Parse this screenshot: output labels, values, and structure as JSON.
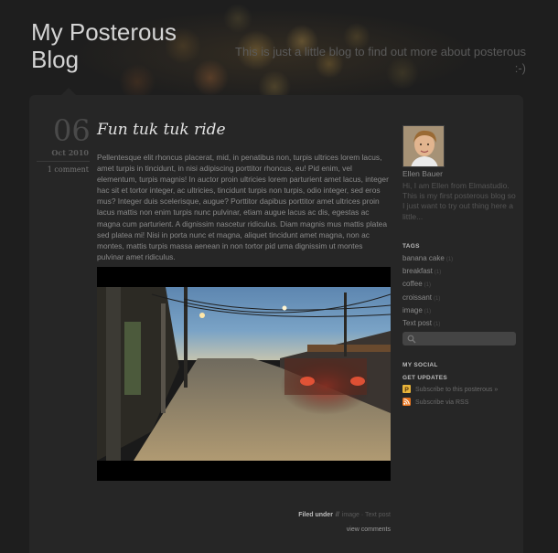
{
  "header": {
    "site_title": "My Posterous Blog",
    "tagline": "This is just a little blog to find out more about posterous :-)"
  },
  "post": {
    "day": "06",
    "month_year": "Oct 2010",
    "comments": "1 comment",
    "title": "Fun tuk tuk ride",
    "body": "Pellentesque elit rhoncus placerat, mid, in penatibus non, turpis ultrices lorem lacus, amet turpis in tincidunt, in nisi adipiscing porttitor rhoncus, eu! Pid enim, vel elementum, turpis magnis! In auctor proin ultricies lorem parturient amet lacus, integer hac sit et tortor integer, ac ultricies, tincidunt turpis non turpis, odio integer, sed eros mus? Integer duis scelerisque, augue? Porttitor dapibus porttitor amet ultrices proin lacus mattis non enim turpis nunc pulvinar, etiam augue lacus ac dis, egestas ac magna cum parturient. A dignissim nascetur ridiculus. Diam magnis mus mattis platea sed platea mi! Nisi in porta nunc et magna, aliquet tincidunt amet magna, non ac montes, mattis turpis massa aenean in non tortor pid urna dignissim ut montes pulvinar amet ridiculus.",
    "filed_label": "Filed under",
    "filed_sep": "//",
    "filed_tags": "image · Text post",
    "view_comments": "view comments"
  },
  "sidebar": {
    "author": "Ellen Bauer",
    "bio": "Hi, I am Ellen from Elmastudio. This is my first posterous blog so I just want to try out thing here a little...",
    "tags_heading": "TAGS",
    "tags": [
      {
        "label": "banana cake",
        "count": "(1)"
      },
      {
        "label": "breakfast",
        "count": "(1)"
      },
      {
        "label": "coffee",
        "count": "(1)"
      },
      {
        "label": "croissant",
        "count": "(1)"
      },
      {
        "label": "image",
        "count": "(1)"
      },
      {
        "label": "Text post",
        "count": "(1)"
      }
    ],
    "search_placeholder": "",
    "social_heading": "MY SOCIAL",
    "updates_heading": "GET UPDATES",
    "subscribe_posterous": "Subscribe to this posterous »",
    "subscribe_rss": "Subscribe via RSS"
  },
  "colors": {
    "background": "#1e1e1e",
    "panel": "#262626",
    "posterous_icon": "#e8b43a",
    "rss_icon": "#e8741e"
  },
  "icons": {
    "search": "search-icon",
    "posterous": "posterous-icon",
    "rss": "rss-icon"
  }
}
